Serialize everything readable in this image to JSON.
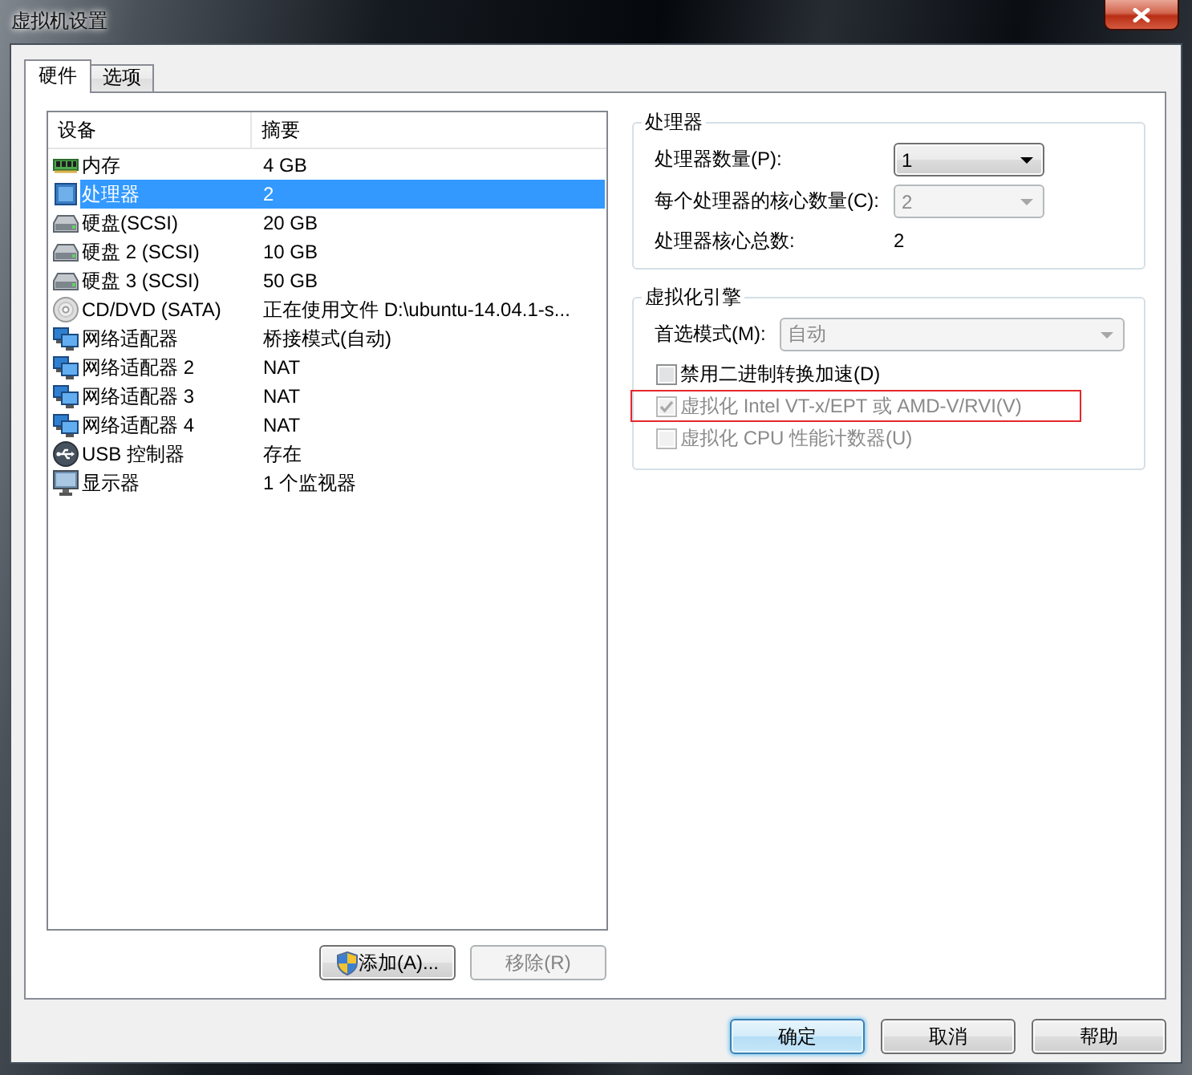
{
  "window": {
    "title": "虚拟机设置"
  },
  "tabs": [
    {
      "label": "硬件",
      "selected": true
    },
    {
      "label": "选项",
      "selected": false
    }
  ],
  "device_table": {
    "columns": [
      "设备",
      "摘要"
    ],
    "rows": [
      {
        "kind": "memory",
        "device": "内存",
        "summary": "4 GB",
        "selected": false
      },
      {
        "kind": "processor",
        "device": "处理器",
        "summary": "2",
        "selected": true
      },
      {
        "kind": "disk",
        "device": "硬盘(SCSI)",
        "summary": "20 GB",
        "selected": false
      },
      {
        "kind": "disk",
        "device": "硬盘 2 (SCSI)",
        "summary": "10 GB",
        "selected": false
      },
      {
        "kind": "disk",
        "device": "硬盘 3 (SCSI)",
        "summary": "50 GB",
        "selected": false
      },
      {
        "kind": "cdrom",
        "device": "CD/DVD (SATA)",
        "summary": "正在使用文件 D:\\ubuntu-14.04.1-s...",
        "selected": false
      },
      {
        "kind": "network",
        "device": "网络适配器",
        "summary": "桥接模式(自动)",
        "selected": false
      },
      {
        "kind": "network",
        "device": "网络适配器 2",
        "summary": "NAT",
        "selected": false
      },
      {
        "kind": "network",
        "device": "网络适配器 3",
        "summary": "NAT",
        "selected": false
      },
      {
        "kind": "network",
        "device": "网络适配器 4",
        "summary": "NAT",
        "selected": false
      },
      {
        "kind": "usb",
        "device": "USB 控制器",
        "summary": "存在",
        "selected": false
      },
      {
        "kind": "display",
        "device": "显示器",
        "summary": "1 个监视器",
        "selected": false
      }
    ]
  },
  "device_buttons": [
    {
      "kind": "elevated",
      "label": "添加(A)...",
      "disabled": false
    },
    {
      "kind": "plain",
      "label": "移除(R)",
      "disabled": true
    }
  ],
  "processors": {
    "title": "处理器",
    "fields": [
      {
        "kind": "dropdown",
        "label": "处理器数量(P):",
        "value": "1",
        "disabled": false
      },
      {
        "kind": "dropdown",
        "label": "每个处理器的核心数量(C):",
        "value": "2",
        "disabled": true
      },
      {
        "kind": "text",
        "label": "处理器核心总数:",
        "value": "2"
      }
    ]
  },
  "virtualization": {
    "title": "虚拟化引擎",
    "mode": {
      "label": "首选模式(M):",
      "value": "自动",
      "disabled": true
    },
    "options": [
      {
        "label": "禁用二进制转换加速(D)",
        "checked": false,
        "disabled": false,
        "highlighted": false
      },
      {
        "label": "虚拟化 Intel VT-x/EPT 或 AMD-V/RVI(V)",
        "checked": true,
        "disabled": true,
        "highlighted": true
      },
      {
        "label": "虚拟化 CPU 性能计数器(U)",
        "checked": false,
        "disabled": true,
        "highlighted": false
      }
    ]
  },
  "dialog_buttons": [
    {
      "label": "确定",
      "default": true
    },
    {
      "label": "取消",
      "default": false
    },
    {
      "label": "帮助",
      "default": false
    }
  ]
}
